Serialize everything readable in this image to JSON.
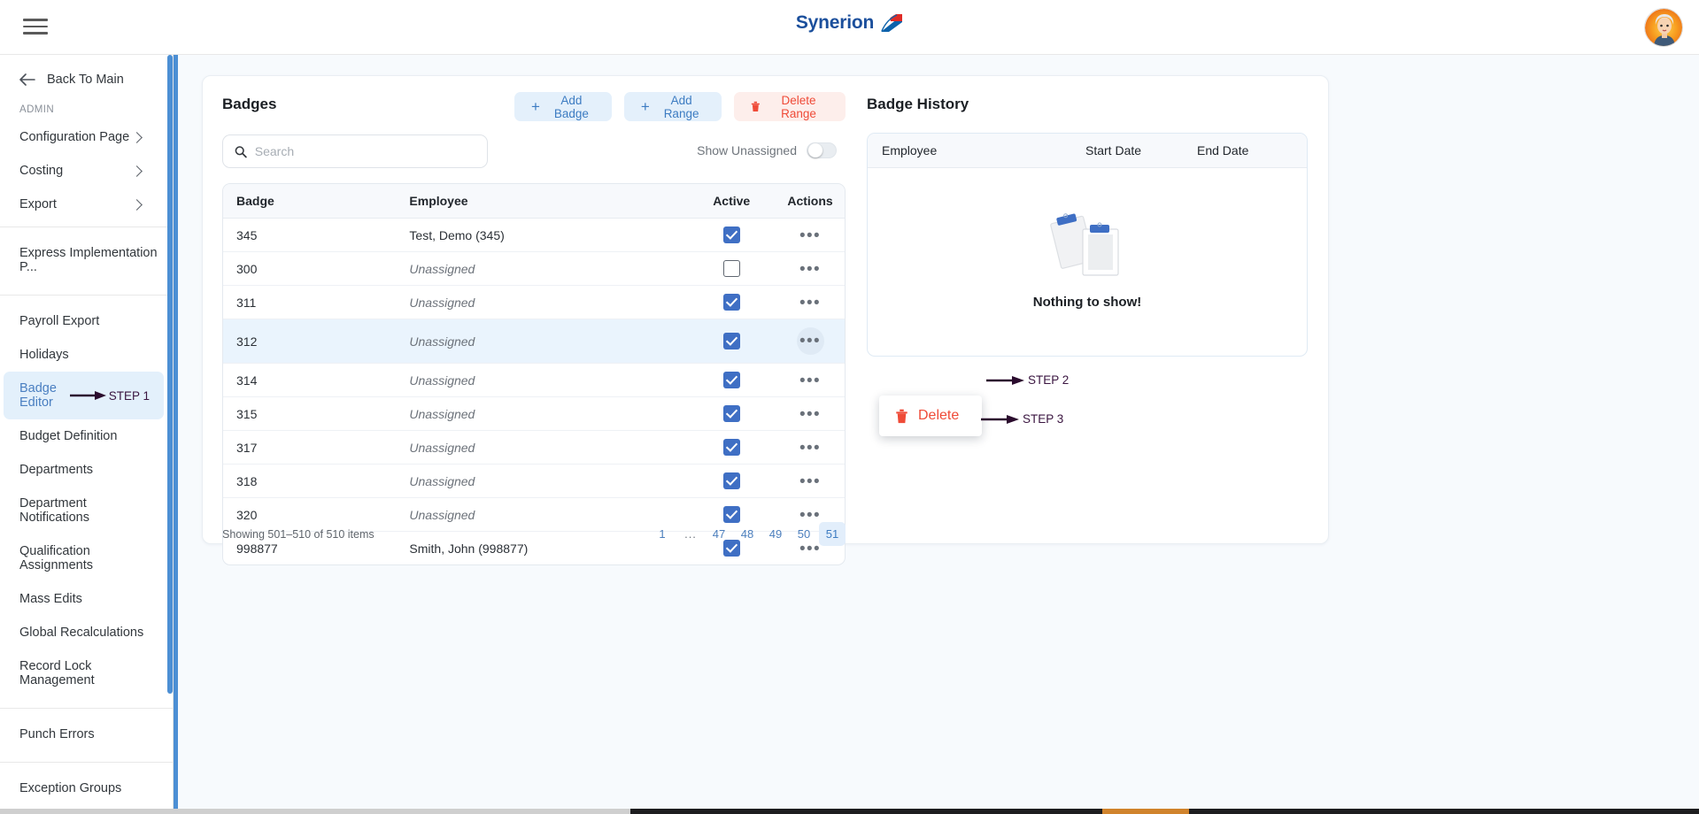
{
  "topbar": {
    "menu_icon": "hamburger-icon",
    "brand_name": "Synerion",
    "brand_mark_icon": "synerion-logo-mark",
    "avatar_icon": "user-avatar"
  },
  "sidebar": {
    "back": {
      "label": "Back To Main",
      "icon": "arrow-left-icon"
    },
    "section_label": "ADMIN",
    "expandable": [
      {
        "label": "Configuration Page",
        "icon": "chevron-right-icon"
      },
      {
        "label": "Costing",
        "icon": "chevron-right-icon"
      },
      {
        "label": "Export",
        "icon": "chevron-right-icon"
      }
    ],
    "express": [
      {
        "label": "Express Implementation P..."
      }
    ],
    "items": [
      {
        "label": "Payroll Export"
      },
      {
        "label": "Holidays"
      },
      {
        "label": "Badge Editor"
      },
      {
        "label": "Budget Definition"
      },
      {
        "label": "Departments"
      },
      {
        "label": "Department Notifications"
      },
      {
        "label": "Qualification Assignments"
      },
      {
        "label": "Mass Edits"
      },
      {
        "label": "Global Recalculations"
      },
      {
        "label": "Record Lock Management"
      }
    ],
    "punch": [
      {
        "label": "Punch Errors"
      }
    ],
    "exception": [
      {
        "label": "Exception Groups"
      }
    ]
  },
  "annotations": {
    "step1": "STEP 1",
    "step2": "STEP 2",
    "step3": "STEP 3"
  },
  "badges": {
    "title": "Badges",
    "buttons": {
      "add_badge": "Add Badge",
      "add_range": "Add Range",
      "delete_range": "Delete Range",
      "plus_icon": "plus-icon",
      "trash_icon": "trash-icon"
    },
    "search": {
      "placeholder": "Search",
      "value": "",
      "icon": "search-icon"
    },
    "show_unassigned": {
      "label": "Show Unassigned",
      "state": "off"
    },
    "columns": [
      "Badge",
      "Employee",
      "Active",
      "Actions"
    ],
    "rows": [
      {
        "badge": "345",
        "employee": "Test, Demo (345)",
        "unassigned": false,
        "active": true,
        "highlight": false
      },
      {
        "badge": "300",
        "employee": "Unassigned",
        "unassigned": true,
        "active": false,
        "highlight": false
      },
      {
        "badge": "311",
        "employee": "Unassigned",
        "unassigned": true,
        "active": true,
        "highlight": false
      },
      {
        "badge": "312",
        "employee": "Unassigned",
        "unassigned": true,
        "active": true,
        "highlight": true
      },
      {
        "badge": "314",
        "employee": "Unassigned",
        "unassigned": true,
        "active": true,
        "highlight": false
      },
      {
        "badge": "315",
        "employee": "Unassigned",
        "unassigned": true,
        "active": true,
        "highlight": false
      },
      {
        "badge": "317",
        "employee": "Unassigned",
        "unassigned": true,
        "active": true,
        "highlight": false
      },
      {
        "badge": "318",
        "employee": "Unassigned",
        "unassigned": true,
        "active": true,
        "highlight": false
      },
      {
        "badge": "320",
        "employee": "Unassigned",
        "unassigned": true,
        "active": true,
        "highlight": false
      },
      {
        "badge": "998877",
        "employee": "Smith, John (998877)",
        "unassigned": false,
        "active": true,
        "highlight": false
      }
    ],
    "showing": "Showing 501–510 of 510 items",
    "pagination": {
      "pages": [
        "1",
        "...",
        "47",
        "48",
        "49",
        "50",
        "51"
      ],
      "current": "51"
    },
    "row_menu": {
      "delete_label": "Delete",
      "icon": "trash-icon"
    }
  },
  "badge_history": {
    "title": "Badge History",
    "columns": [
      "Employee",
      "Start Date",
      "End Date"
    ],
    "empty_message": "Nothing to show!",
    "empty_icon": "clipboard-empty-illustration",
    "rows": []
  },
  "colors": {
    "accent_blue": "#4c8fd4",
    "brand_navy": "#1b4f9c",
    "soft_blue_bg": "#e4f0fb",
    "danger_red": "#ef4b38",
    "checkbox_blue": "#3f6fc4",
    "row_highlight": "#eaf4fd",
    "annotation_purple": "#3a1540",
    "canvas_bg": "#f7fafd"
  }
}
